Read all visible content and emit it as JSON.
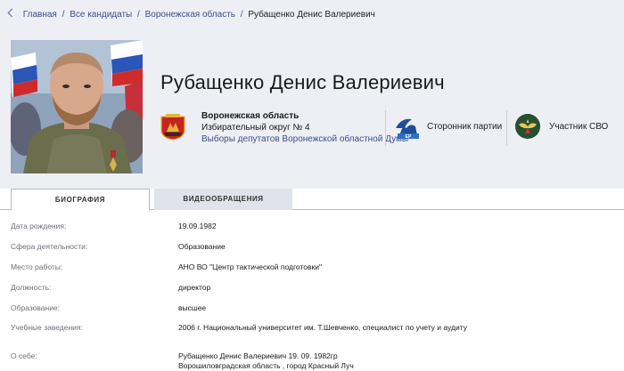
{
  "breadcrumb": {
    "items": [
      "Главная",
      "Все кандидаты",
      "Воронежская область"
    ],
    "separator": "/",
    "current": "Рубащенко Денис Валериевич"
  },
  "candidate": {
    "name": "Рубащенко Денис Валериевич",
    "region": "Воронежская область",
    "district": "Избирательный округ № 4",
    "elections": "Выборы депутатов Воронежской областной Думы",
    "party_label": "Сторонник партии",
    "svo_label": "Участник СВО"
  },
  "tabs": [
    {
      "label": "БИОГРАФИЯ",
      "active": true
    },
    {
      "label": "ВИДЕООБРАЩЕНИЯ",
      "active": false
    }
  ],
  "bio": {
    "rows": [
      {
        "label": "Дата рождения:",
        "value": "19.09.1982"
      },
      {
        "label": "Сфера деятельности:",
        "value": "Образование"
      },
      {
        "label": "Место работы:",
        "value": "АНО ВО \"Центр тактической подготовки\""
      },
      {
        "label": "Должность:",
        "value": "директор"
      },
      {
        "label": "Образование:",
        "value": "высшее"
      },
      {
        "label": "Учебные заведения:",
        "value": "2006 г. Национальный университет им. Т.Шевченко, специалист по учету и аудиту"
      },
      {
        "label": "О себе:",
        "value": "Рубащенко Денис Валериевич 19. 09. 1982гр",
        "value2": "Ворошиловградская область , город Красный Луч"
      }
    ]
  },
  "colors": {
    "header_bg": "#eeeff5",
    "link": "#3a4f8a",
    "svo_green": "#26502f",
    "party_blue": "#1f4e9a",
    "crest_red": "#c8241e"
  },
  "icons": {
    "back": "chevron-left-icon",
    "region_crest": "region-crest-icon",
    "party": "party-logo-icon",
    "svo": "svo-emblem-icon"
  }
}
